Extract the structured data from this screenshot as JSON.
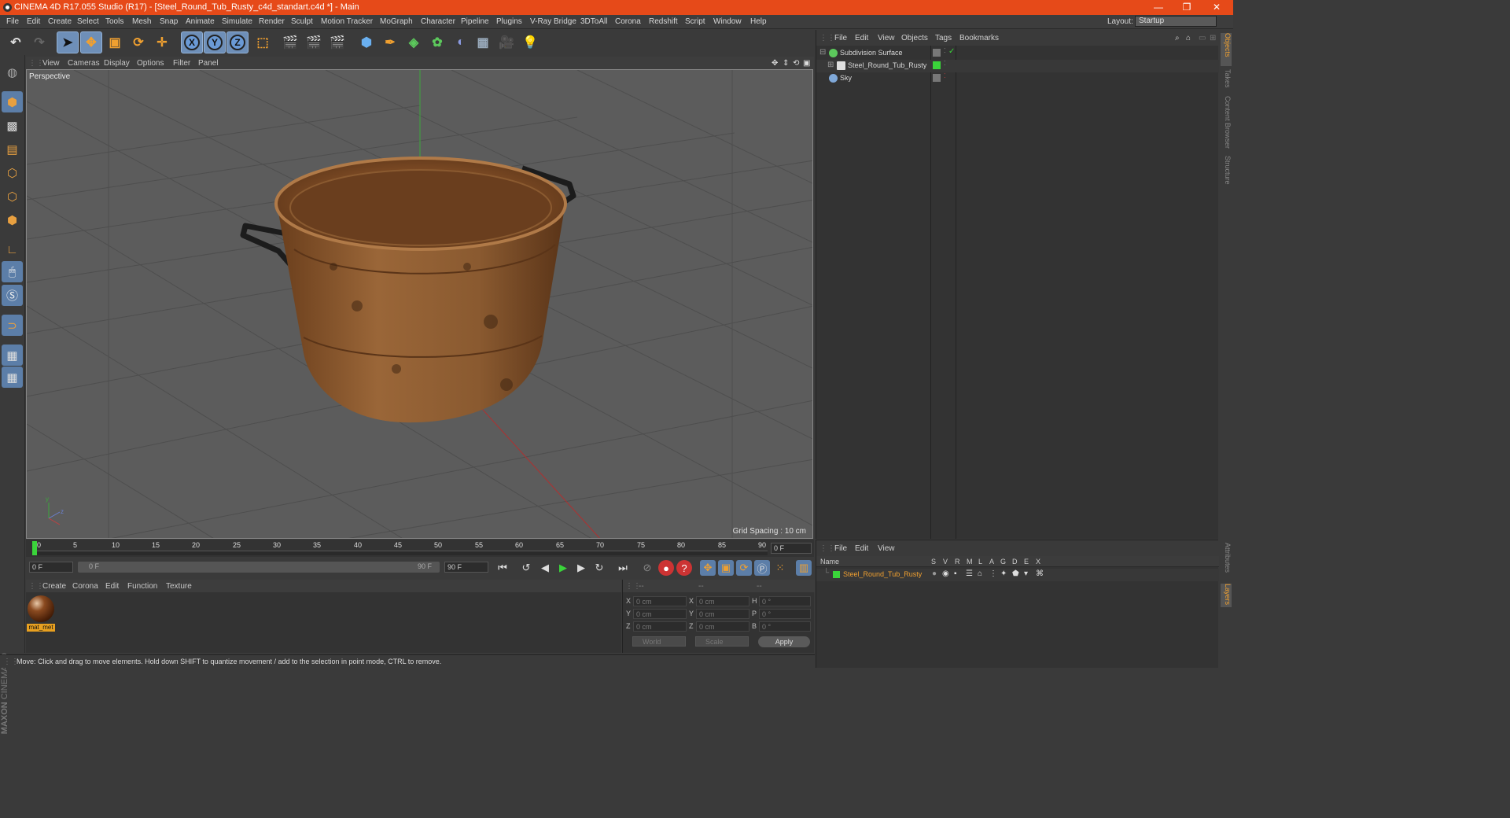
{
  "window": {
    "title": "CINEMA 4D R17.055 Studio (R17) - [Steel_Round_Tub_Rusty_c4d_standart.c4d *] - Main",
    "minimize": "—",
    "restore": "❐",
    "close": "✕"
  },
  "menu": [
    "File",
    "Edit",
    "Create",
    "Select",
    "Tools",
    "Mesh",
    "Snap",
    "Animate",
    "Simulate",
    "Render",
    "Sculpt",
    "Motion Tracker",
    "MoGraph",
    "Character",
    "Pipeline",
    "Plugins",
    "V-Ray Bridge",
    "3DToAll",
    "Corona",
    "Redshift",
    "Script",
    "Window",
    "Help"
  ],
  "layout": {
    "label": "Layout:",
    "value": "Startup"
  },
  "toolbar": {
    "x": "X",
    "y": "Y",
    "z": "Z"
  },
  "viewport": {
    "menu": [
      "View",
      "Cameras",
      "Display",
      "Options",
      "Filter",
      "Panel"
    ],
    "label": "Perspective",
    "grid_spacing": "Grid Spacing : 10 cm",
    "axis_y": "y",
    "axis_z": "z"
  },
  "timeline": {
    "ticks": [
      "0",
      "5",
      "10",
      "15",
      "20",
      "25",
      "30",
      "35",
      "40",
      "45",
      "50",
      "55",
      "60",
      "65",
      "70",
      "75",
      "80",
      "85",
      "90"
    ],
    "end_frame": "0 F",
    "current_frame": "0 F",
    "range_start": "0 F",
    "range_end": "90 F",
    "max_frame": "90 F"
  },
  "materials": {
    "menu": [
      "Create",
      "Corona",
      "Edit",
      "Function",
      "Texture"
    ],
    "items": [
      {
        "name": "mat_met"
      }
    ]
  },
  "coordinates": {
    "header": [
      "--",
      "--",
      "--"
    ],
    "rows": [
      {
        "l1": "X",
        "v1": "0 cm",
        "l2": "X",
        "v2": "0 cm",
        "l3": "H",
        "v3": "0 °"
      },
      {
        "l1": "Y",
        "v1": "0 cm",
        "l2": "Y",
        "v2": "0 cm",
        "l3": "P",
        "v3": "0 °"
      },
      {
        "l1": "Z",
        "v1": "0 cm",
        "l2": "Z",
        "v2": "0 cm",
        "l3": "B",
        "v3": "0 °"
      }
    ],
    "mode": "World",
    "type": "Scale",
    "apply": "Apply"
  },
  "status": "Move: Click and drag to move elements. Hold down SHIFT to quantize movement / add to the selection in point mode, CTRL to remove.",
  "objects": {
    "menu": [
      "File",
      "Edit",
      "View",
      "Objects",
      "Tags",
      "Bookmarks"
    ],
    "items": [
      {
        "name": "Subdivision Surface",
        "icon_color": "#5cc85c"
      },
      {
        "name": "Steel_Round_Tub_Rusty",
        "icon_color": "#e0e0e0"
      },
      {
        "name": "Sky",
        "icon_color": "#7fa8d8"
      }
    ]
  },
  "layers": {
    "menu": [
      "File",
      "Edit",
      "View"
    ],
    "columns": [
      "Name",
      "S",
      "V",
      "R",
      "M",
      "L",
      "A",
      "G",
      "D",
      "E",
      "X"
    ],
    "items": [
      {
        "name": "Steel_Round_Tub_Rusty",
        "color": "#3ad43a"
      }
    ]
  },
  "side_tabs": [
    "Objects",
    "Takes",
    "Content Browser",
    "Structure",
    "Attributes",
    "Layers"
  ],
  "branding": {
    "maxon": "MAXON",
    "c4d": "CINEMA 4D"
  },
  "colors": {
    "accent": "#e64a19",
    "selection": "#f0a030"
  }
}
